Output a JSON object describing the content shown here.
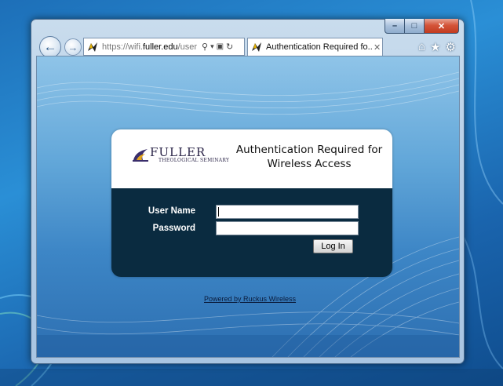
{
  "window": {
    "controls": {
      "minimize": "–",
      "maximize": "□",
      "close": "✕"
    }
  },
  "toolbar": {
    "back_icon": "back-arrow-icon",
    "forward_icon": "forward-arrow-icon",
    "url_prefix": "https://wifi.",
    "url_domain": "fuller.edu",
    "url_suffix": "/user",
    "search_glyph": "⚲",
    "dropdown_glyph": "▾",
    "lock_glyph": "🔒",
    "refresh_glyph": "↻"
  },
  "tab": {
    "title": "Authentication Required fo...",
    "close": "✕"
  },
  "right_icons": {
    "home": "⌂",
    "favorites": "★",
    "tools": "⚙"
  },
  "page": {
    "logo_word": "FULLER",
    "logo_sub": "THEOLOGICAL SEMINARY",
    "heading_line1": "Authentication Required for",
    "heading_line2": "Wireless Access",
    "username_label": "User Name",
    "password_label": "Password",
    "username_value": "",
    "password_value": "",
    "login_label": "Log In",
    "powered_by": "Powered by Ruckus Wireless"
  },
  "colors": {
    "card_dark": "#0a2b40",
    "card_light": "#ffffff",
    "close_red": "#c23a1f",
    "desktop_blue": "#1d6fb8"
  }
}
